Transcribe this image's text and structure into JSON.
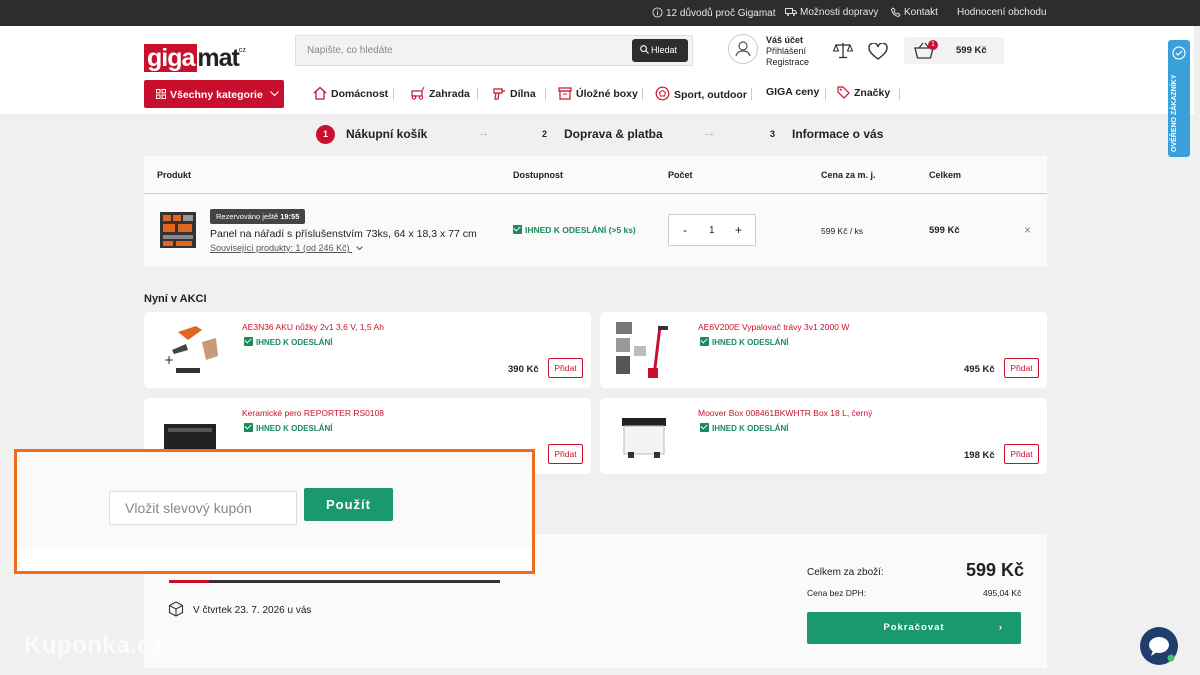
{
  "topbar": {
    "reasons": "12 důvodů proč Gigamat",
    "shipping": "Možnosti dopravy",
    "contact": "Kontakt",
    "rating": "Hodnocení obchodu"
  },
  "logo": {
    "part1": "giga",
    "part2": "mat",
    "suffix": "cz"
  },
  "search": {
    "placeholder": "Napište, co hledáte",
    "button": "Hledat"
  },
  "account": {
    "title": "Váš účet",
    "login": "Přihlášení",
    "register": "Registrace"
  },
  "cart": {
    "count": "1",
    "price": "599 Kč"
  },
  "nav": {
    "all_categories": "Všechny kategorie",
    "items": [
      "Domácnost",
      "Zahrada",
      "Dílna",
      "Úložné boxy",
      "Sport, outdoor",
      "GIGA ceny",
      "Značky"
    ]
  },
  "steps": [
    {
      "num": "1",
      "label": "Nákupní košík"
    },
    {
      "num": "2",
      "label": "Doprava & platba"
    },
    {
      "num": "3",
      "label": "Informace o vás"
    }
  ],
  "table": {
    "headers": [
      "Produkt",
      "Dostupnost",
      "Počet",
      "Cena za m. j.",
      "Celkem"
    ],
    "row": {
      "reserved_prefix": "Rezervováno ještě",
      "reserved_time": "19:55",
      "name": "Panel na nářadí s příslušenstvím 73ks, 64 x 18,3 x 77 cm",
      "related": "Související produkty: 1 (od 246 Kč)",
      "availability": "IHNED K ODESLÁNÍ (>5 ks)",
      "qty": "1",
      "minus": "-",
      "plus": "+",
      "unit_price": "599 Kč / ks",
      "total": "599 Kč",
      "remove": "×"
    }
  },
  "promo": {
    "title": "Nyní v AKCI",
    "add_label": "Přidat",
    "items": [
      {
        "name": "AE3N36 AKU nůžky 2v1 3,6 V, 1,5 Ah",
        "availability": "IHNED K ODESLÁNÍ",
        "price": "390 Kč"
      },
      {
        "name": "AE6V200E Vypalovač trávy 3v1 2000 W",
        "availability": "IHNED K ODESLÁNÍ",
        "price": "495 Kč"
      },
      {
        "name": "Keramické pero REPORTER RS0108",
        "availability": "IHNED K ODESLÁNÍ",
        "price": ""
      },
      {
        "name": "Moover Box 008461BKWHTR Box 18 L, černý",
        "availability": "IHNED K ODESLÁNÍ",
        "price": "198 Kč"
      }
    ]
  },
  "coupon": {
    "placeholder": "Vložit slevový kupón",
    "apply": "Použít"
  },
  "delivery": {
    "text": "V čtvrtek 23. 7. 2026 u vás",
    "progress": 0.12
  },
  "summary": {
    "total_label": "Celkem za zboží:",
    "total_value": "599 Kč",
    "net_label": "Cena bez DPH:",
    "net_value": "495,04 Kč",
    "continue": "Pokračovat"
  },
  "side_tab": "OVĚŘENO ZÁKAZNÍKY",
  "watermark": "Kuponka.cz",
  "colors": {
    "brand_red": "#c8102e",
    "green": "#1a9a6c",
    "highlight_orange": "#f26b1d",
    "dark": "#2d2d2d"
  }
}
